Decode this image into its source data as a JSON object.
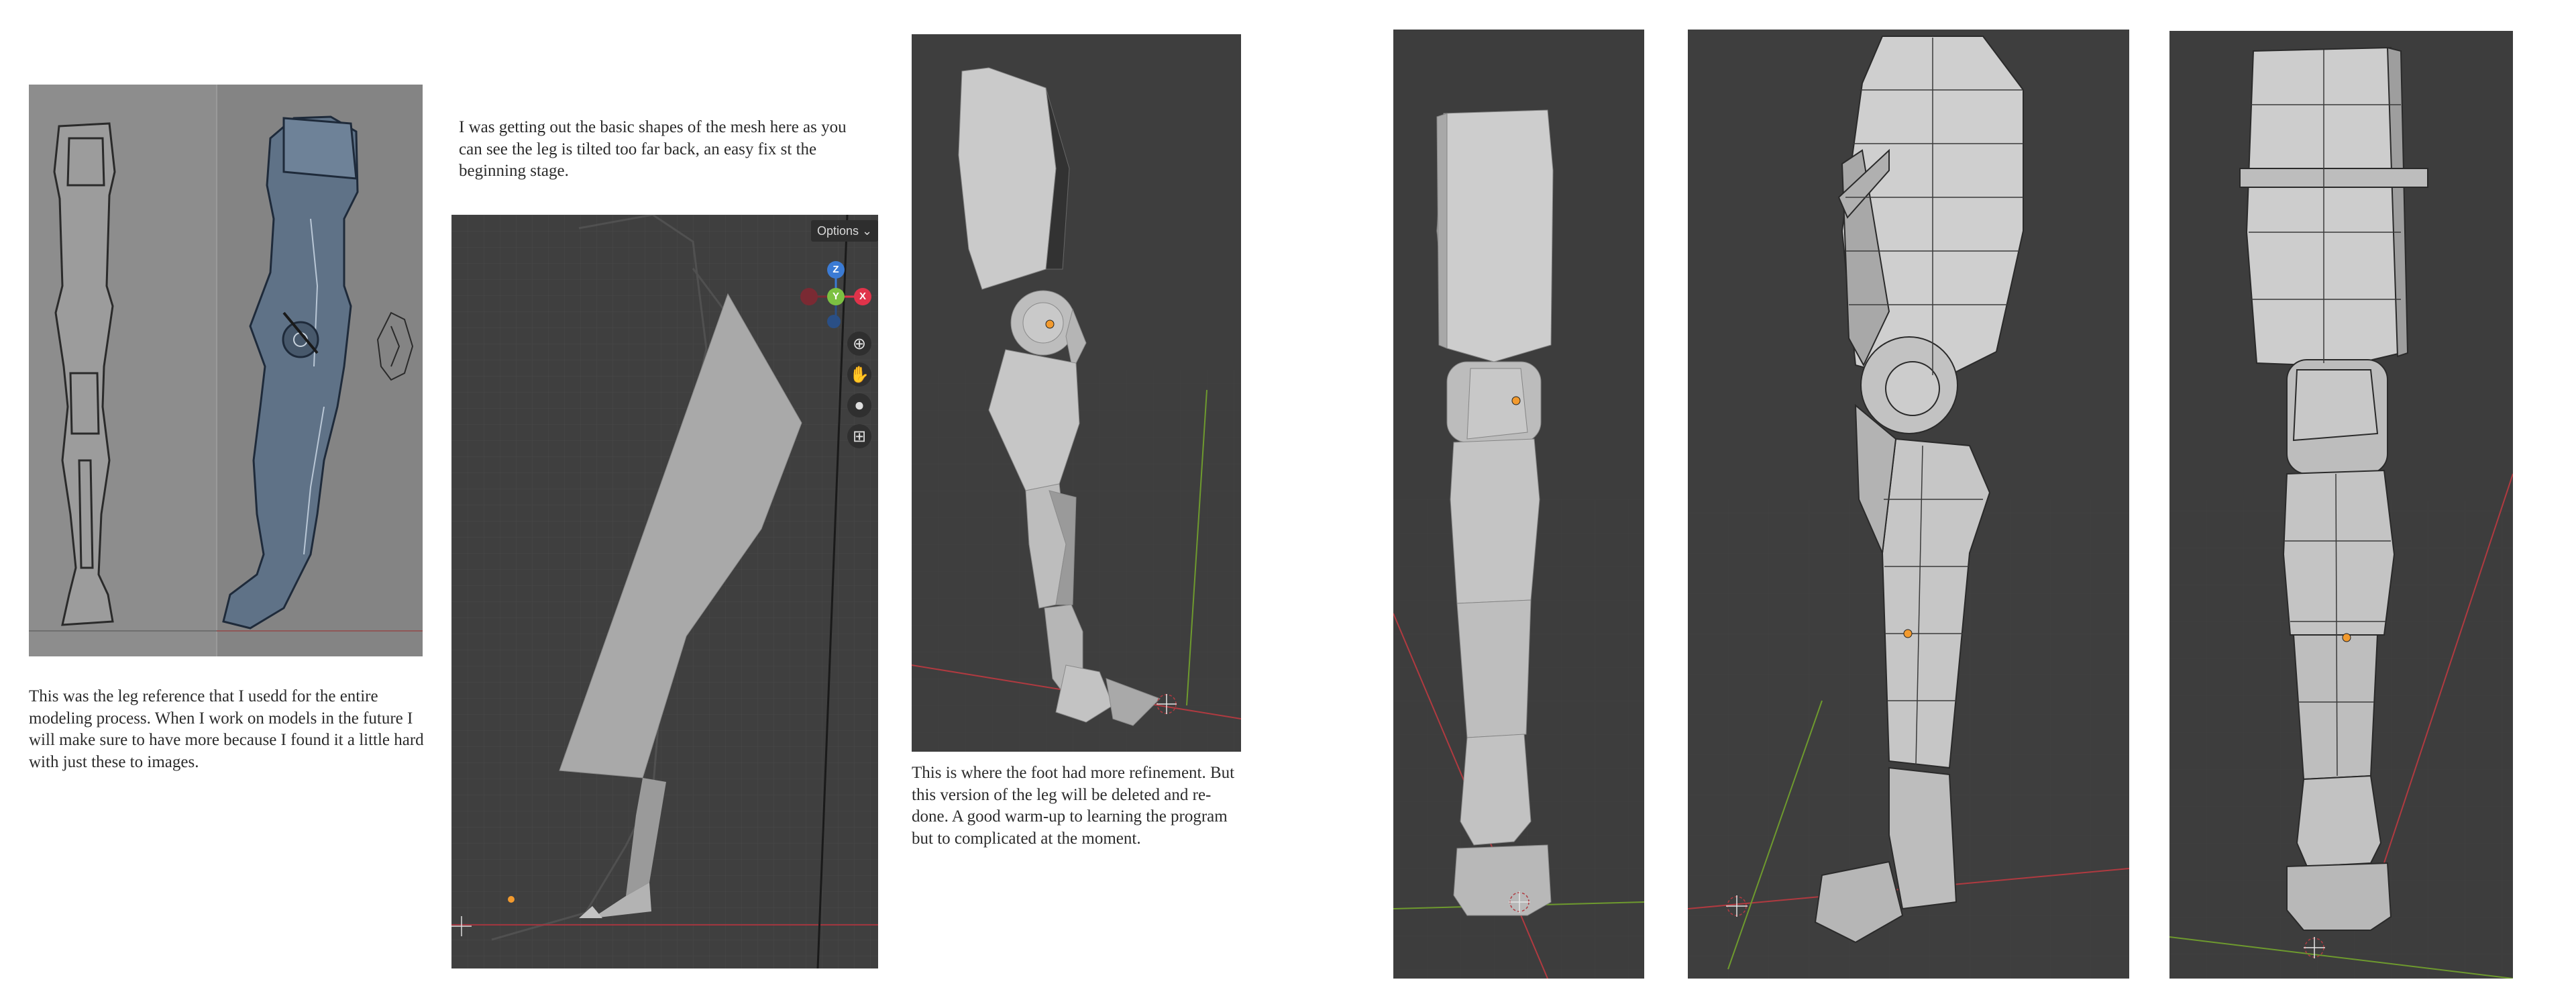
{
  "captions": {
    "reference": "This was the leg reference that I usedd for the entire modeling process. When I work on models in the future I will make sure to have more because I found it a little hard with just these to images.",
    "basic_shapes": "I was getting out the basic shapes of the mesh here as you can see the leg is tilted too far back, an easy fix st the beginning stage.",
    "foot_refinement": "This is where the foot had more refinement. But this version of the leg will be deleted and re-done. A good warm-up to learning the program but to complicated at the moment."
  },
  "viewport": {
    "options_label": "Options ⌄",
    "gizmo": {
      "z": "Z",
      "y": "Y",
      "x": "X"
    },
    "nav_icons": [
      "zoom-icon",
      "hand-pan-icon",
      "camera-icon",
      "grid-icon"
    ]
  },
  "colors": {
    "viewport_bg": "#3d3d3d",
    "reference_bg": "#8a8a8a",
    "mesh_gray": "#bdbdbd",
    "axis_red": "#c2353e",
    "axis_green": "#6e9a2e",
    "gizmo_blue": "#3b7bd4",
    "gizmo_green": "#7cc142",
    "gizmo_red": "#e0334a",
    "origin_orange": "#f29a2e"
  }
}
